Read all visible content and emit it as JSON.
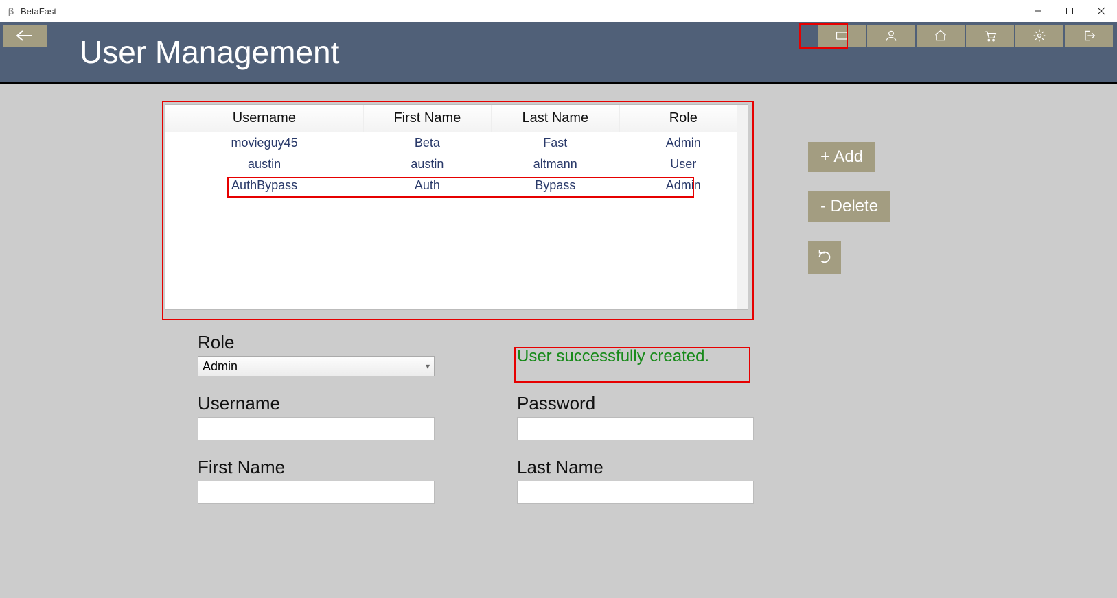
{
  "window": {
    "title": "BetaFast"
  },
  "header": {
    "page_title": "User Management"
  },
  "table": {
    "columns": [
      "Username",
      "First Name",
      "Last Name",
      "Role"
    ],
    "rows": [
      {
        "username": "movieguy45",
        "first": "Beta",
        "last": "Fast",
        "role": "Admin"
      },
      {
        "username": "austin",
        "first": "austin",
        "last": "altmann",
        "role": "User"
      },
      {
        "username": "AuthBypass",
        "first": "Auth",
        "last": "Bypass",
        "role": "Admin"
      }
    ]
  },
  "buttons": {
    "add": "+ Add",
    "delete": "- Delete"
  },
  "form": {
    "role_label": "Role",
    "role_value": "Admin",
    "username_label": "Username",
    "username_value": "",
    "password_label": "Password",
    "password_value": "",
    "firstname_label": "First Name",
    "firstname_value": "",
    "lastname_label": "Last Name",
    "lastname_value": ""
  },
  "status": {
    "message": "User successfully created."
  }
}
